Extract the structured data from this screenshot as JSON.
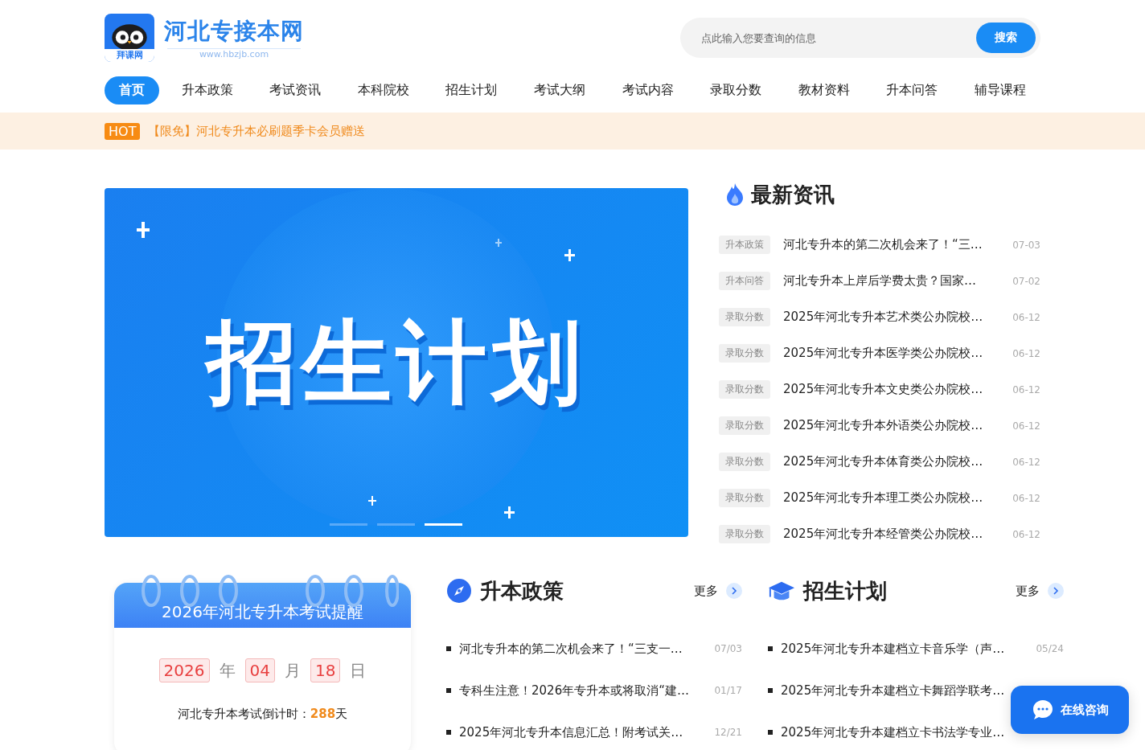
{
  "logo": {
    "title": "河北专接本网",
    "url": "www.hbzjb.com",
    "badge": "拜课网"
  },
  "search": {
    "placeholder": "点此输入您要查询的信息",
    "button": "搜索"
  },
  "nav": [
    {
      "label": "首页",
      "selected": true
    },
    {
      "label": "升本政策",
      "selected": false
    },
    {
      "label": "考试资讯",
      "selected": false
    },
    {
      "label": "本科院校",
      "selected": false
    },
    {
      "label": "招生计划",
      "selected": false
    },
    {
      "label": "考试大纲",
      "selected": false
    },
    {
      "label": "考试内容",
      "selected": false
    },
    {
      "label": "录取分数",
      "selected": false
    },
    {
      "label": "教材资料",
      "selected": false
    },
    {
      "label": "升本问答",
      "selected": false
    },
    {
      "label": "辅导课程",
      "selected": false
    }
  ],
  "notice": {
    "badge": "HOT",
    "text": "【限免】河北专升本必刷题季卡会员赠送"
  },
  "banner": {
    "title": "招生计划",
    "slides": [
      {
        "selected": false
      },
      {
        "selected": false
      },
      {
        "selected": true
      }
    ]
  },
  "latest": {
    "title": "最新资讯",
    "items": [
      {
        "tag": "升本政策",
        "title": "河北专升本的第二次机会来了！“三…",
        "date": "07-03"
      },
      {
        "tag": "升本问答",
        "title": "河北专升本上岸后学费太贵？国家…",
        "date": "07-02"
      },
      {
        "tag": "录取分数",
        "title": "2025年河北专升本艺术类公办院校…",
        "date": "06-12"
      },
      {
        "tag": "录取分数",
        "title": "2025年河北专升本医学类公办院校…",
        "date": "06-12"
      },
      {
        "tag": "录取分数",
        "title": "2025年河北专升本文史类公办院校…",
        "date": "06-12"
      },
      {
        "tag": "录取分数",
        "title": "2025年河北专升本外语类公办院校…",
        "date": "06-12"
      },
      {
        "tag": "录取分数",
        "title": "2025年河北专升本体育类公办院校…",
        "date": "06-12"
      },
      {
        "tag": "录取分数",
        "title": "2025年河北专升本理工类公办院校…",
        "date": "06-12"
      },
      {
        "tag": "录取分数",
        "title": "2025年河北专升本经管类公办院校…",
        "date": "06-12"
      }
    ]
  },
  "reminder": {
    "title": "2026年河北专升本考试提醒",
    "year": "2026",
    "year_unit": "年",
    "month": "04",
    "month_unit": "月",
    "day": "18",
    "day_unit": "日",
    "countdown": "河北专升本考试倒计时：**288**天"
  },
  "sections": [
    {
      "kind": "compass",
      "title": "升本政策",
      "more": "更多",
      "items": [
        {
          "title": "河北专升本的第二次机会来了！“三支一…",
          "date": "07/03"
        },
        {
          "title": "专科生注意！2026年专升本或将取消“建…",
          "date": "01/17"
        },
        {
          "title": "2025年河北专升本信息汇总！附考试关…",
          "date": "12/21"
        }
      ]
    },
    {
      "kind": "cap",
      "title": "招生计划",
      "more": "更多",
      "items": [
        {
          "title": "2025年河北专升本建档立卡音乐学（声…",
          "date": "05/24"
        },
        {
          "title": "2025年河北专升本建档立卡舞蹈学联考…"
        },
        {
          "title": "2025年河北专升本建档立卡书法学专业…"
        }
      ]
    }
  ],
  "chat": {
    "label": "在线咨询"
  }
}
